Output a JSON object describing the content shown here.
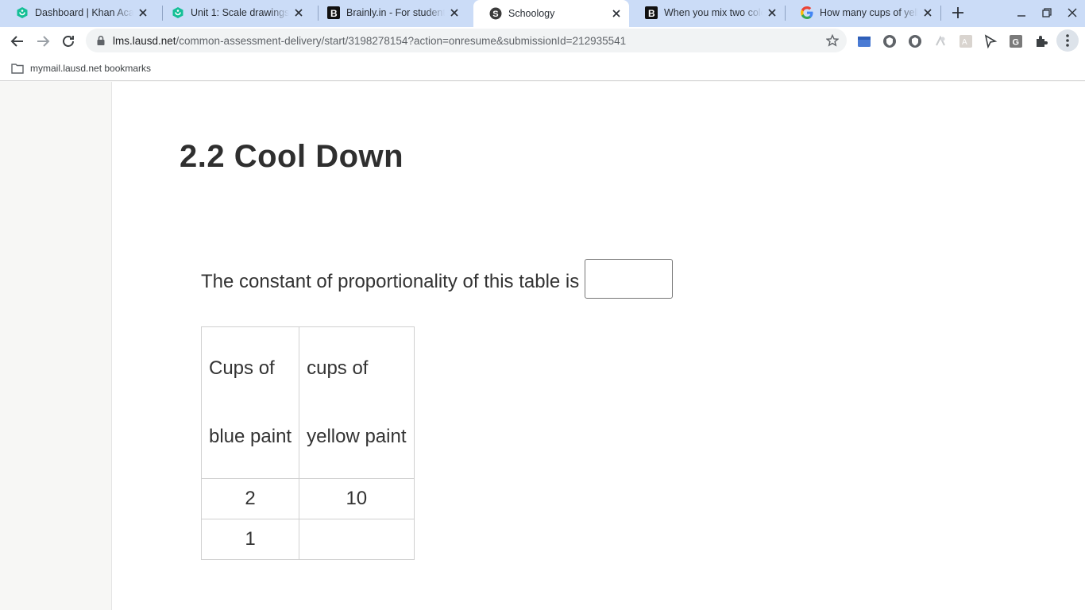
{
  "browser": {
    "tabs": [
      {
        "title": "Dashboard | Khan Academy",
        "favicon": "khan-academy-icon",
        "active": false
      },
      {
        "title": "Unit 1: Scale drawings | Khan Academy",
        "favicon": "khan-academy-icon",
        "active": false
      },
      {
        "title": "Brainly.in - For students. By students.",
        "favicon": "brainly-icon",
        "active": false
      },
      {
        "title": "Schoology",
        "favicon": "schoology-icon",
        "active": true
      },
      {
        "title": "When you mix two colors",
        "favicon": "brainly-icon",
        "active": false
      },
      {
        "title": "How many cups of yellow",
        "favicon": "google-icon",
        "active": false
      }
    ],
    "url_host": "lms.lausd.net",
    "url_path": "/common-assessment-delivery/start/3198278154?action=onresume&submissionId=212935541",
    "bookmarks": [
      {
        "label": "mymail.lausd.net bookmarks",
        "icon": "folder-icon"
      }
    ],
    "colors": {
      "tabstrip": "#cbdcf7",
      "khan": "#14bf96",
      "schoology": "#3b3b3b",
      "google_blue": "#4285f4"
    }
  },
  "page": {
    "title": "2.2 Cool Down",
    "prompt": "The constant of proportionality of this table is",
    "answer_value": "",
    "table": {
      "headers": [
        [
          "Cups of",
          "blue paint"
        ],
        [
          "cups of",
          "yellow paint"
        ]
      ],
      "rows": [
        [
          "2",
          "10"
        ],
        [
          "1",
          ""
        ]
      ]
    }
  }
}
